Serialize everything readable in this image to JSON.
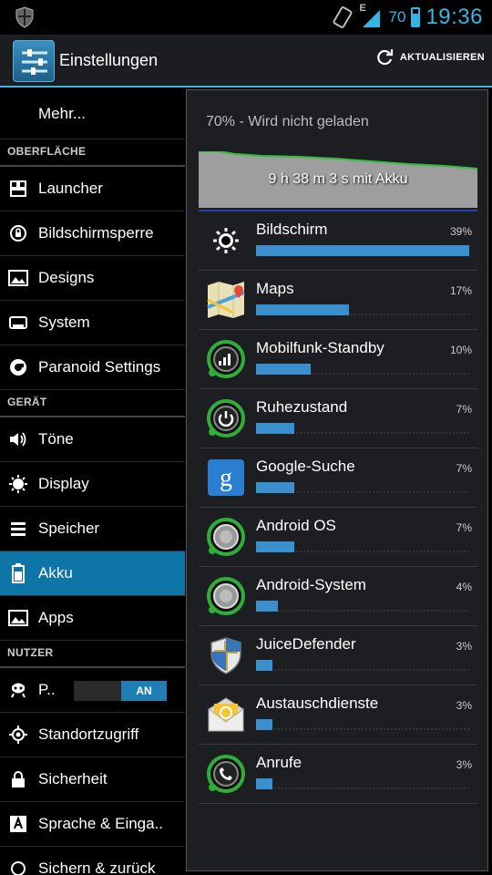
{
  "statusbar": {
    "network": "E",
    "battery_level": "70",
    "time": "19:36"
  },
  "actionbar": {
    "title": "Einstellungen",
    "refresh_label": "AKTUALISIEREN"
  },
  "left_list": {
    "more": "Mehr...",
    "sections": [
      {
        "header": "OBERFLÄCHE",
        "items": [
          {
            "label": "Launcher",
            "icon": "launcher-icon"
          },
          {
            "label": "Bildschirmsperre",
            "icon": "lock-screen-icon"
          },
          {
            "label": "Designs",
            "icon": "designs-icon"
          },
          {
            "label": "System",
            "icon": "system-icon"
          },
          {
            "label": "Paranoid Settings",
            "icon": "paranoid-icon"
          }
        ]
      },
      {
        "header": "GERÄT",
        "items": [
          {
            "label": "Töne",
            "icon": "sound-icon"
          },
          {
            "label": "Display",
            "icon": "display-icon"
          },
          {
            "label": "Speicher",
            "icon": "storage-icon"
          },
          {
            "label": "Akku",
            "icon": "battery-icon",
            "selected": true
          },
          {
            "label": "Apps",
            "icon": "apps-icon"
          }
        ]
      },
      {
        "header": "NUTZER",
        "items": [
          {
            "label": "P..",
            "icon": "privacy-icon",
            "toggle": "AN"
          },
          {
            "label": "Standortzugriff",
            "icon": "location-icon"
          },
          {
            "label": "Sicherheit",
            "icon": "security-icon"
          },
          {
            "label": "Sprache & Einga..",
            "icon": "language-icon"
          },
          {
            "label": "Sichern & zurück",
            "icon": "backup-icon"
          }
        ]
      }
    ]
  },
  "battery": {
    "status": "70% - Wird nicht geladen",
    "graph_label": "9 h 38 m 3 s mit Akku",
    "accent_color": "#33b5e5",
    "usage": [
      {
        "name": "Bildschirm",
        "percent": "39%",
        "value": 39,
        "icon": "brightness-icon"
      },
      {
        "name": "Maps",
        "percent": "17%",
        "value": 17,
        "icon": "maps-icon"
      },
      {
        "name": "Mobilfunk-Standby",
        "percent": "10%",
        "value": 10,
        "icon": "cell-standby-icon"
      },
      {
        "name": "Ruhezustand",
        "percent": "7%",
        "value": 7,
        "icon": "power-icon"
      },
      {
        "name": "Google-Suche",
        "percent": "7%",
        "value": 7,
        "icon": "google-search-icon"
      },
      {
        "name": "Android OS",
        "percent": "7%",
        "value": 7,
        "icon": "android-os-icon"
      },
      {
        "name": "Android-System",
        "percent": "4%",
        "value": 4,
        "icon": "android-system-icon"
      },
      {
        "name": "JuiceDefender",
        "percent": "3%",
        "value": 3,
        "icon": "juicedefender-icon"
      },
      {
        "name": "Austauschdienste",
        "percent": "3%",
        "value": 3,
        "icon": "exchange-icon"
      },
      {
        "name": "Anrufe",
        "percent": "3%",
        "value": 3,
        "icon": "phone-icon"
      }
    ]
  }
}
